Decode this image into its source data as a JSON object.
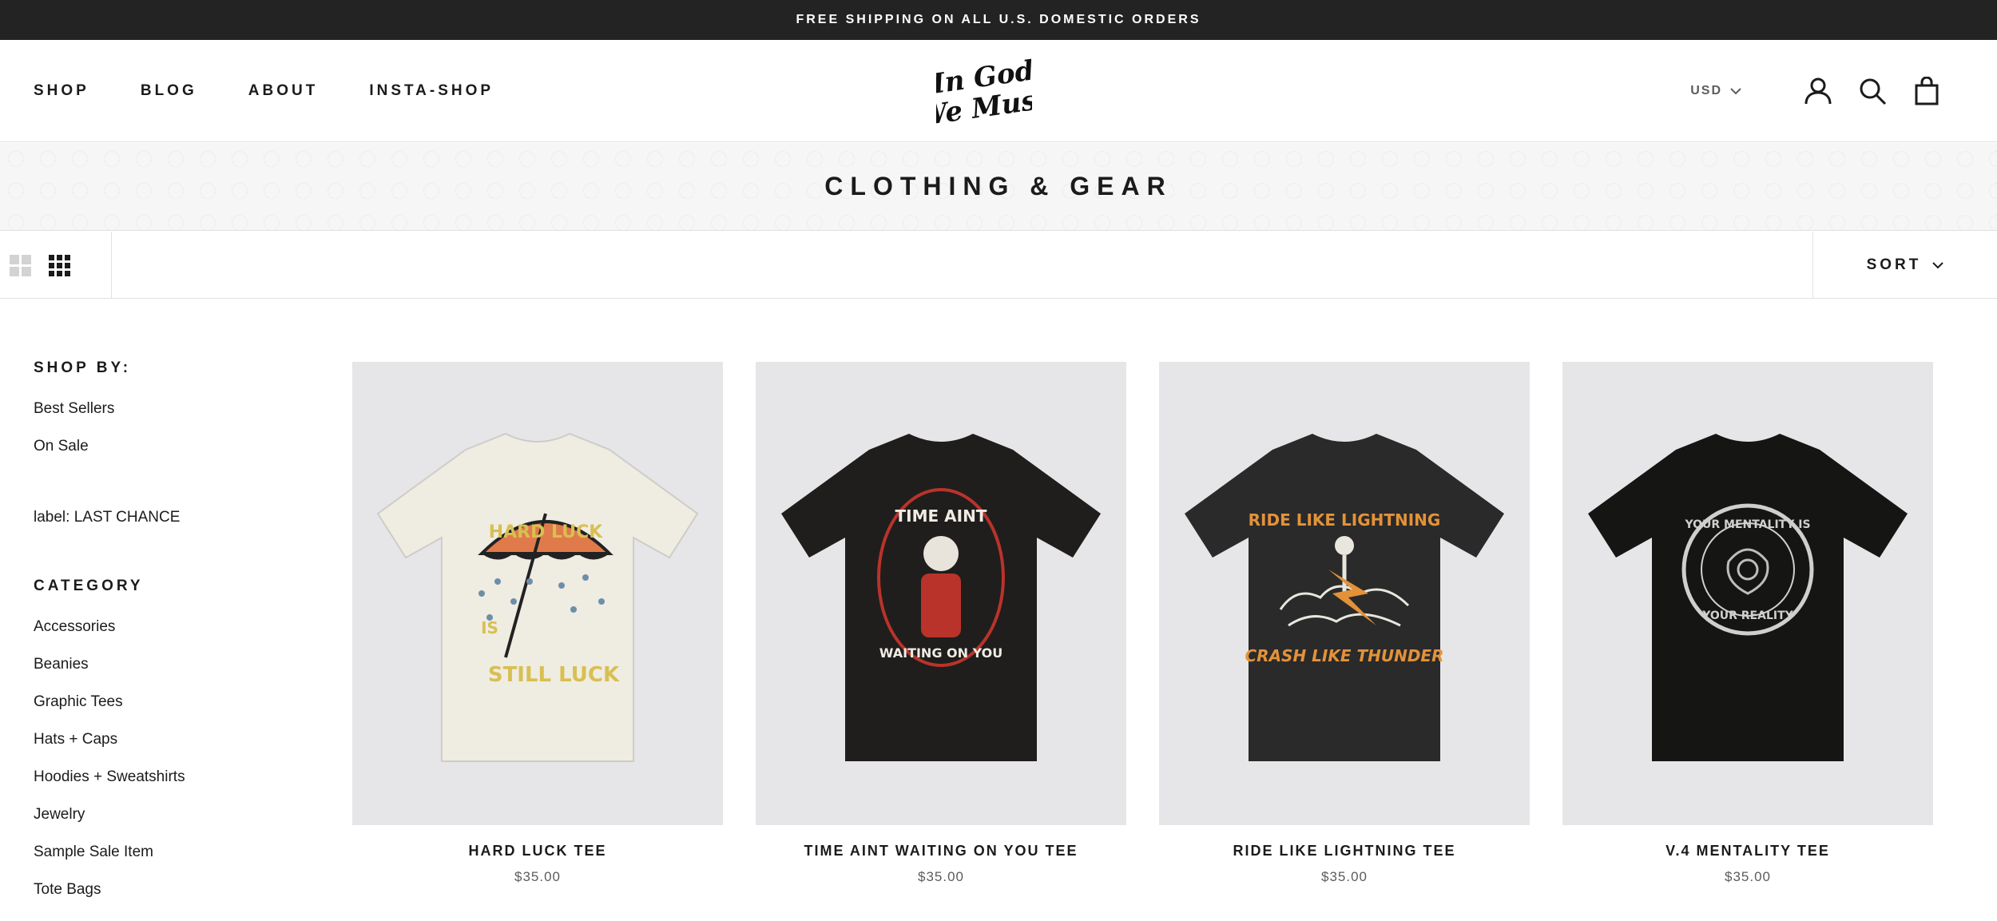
{
  "announcement": "FREE SHIPPING ON ALL U.S. DOMESTIC ORDERS",
  "nav": {
    "items": [
      "SHOP",
      "BLOG",
      "ABOUT",
      "INSTA-SHOP"
    ]
  },
  "logo": {
    "text_line1": "In God",
    "text_line2": "We Must"
  },
  "header": {
    "currency": "USD",
    "icons": [
      "account-icon",
      "search-icon",
      "cart-icon"
    ]
  },
  "collection": {
    "title": "CLOTHING & GEAR"
  },
  "toolbar": {
    "sort_label": "SORT",
    "layout_options": [
      "grid-2-icon",
      "grid-3-icon"
    ]
  },
  "sidebar": {
    "shop_by_heading": "SHOP BY:",
    "shop_by": [
      "Best Sellers",
      "On Sale"
    ],
    "label_filter": "label: LAST CHANCE",
    "category_heading": "CATEGORY",
    "categories": [
      "Accessories",
      "Beanies",
      "Graphic Tees",
      "Hats + Caps",
      "Hoodies + Sweatshirts",
      "Jewelry",
      "Sample Sale Item",
      "Tote Bags"
    ]
  },
  "products": [
    {
      "name": "HARD LUCK TEE",
      "price": "$35.00",
      "shirt_color": "#efece2",
      "graphic": {
        "top_text": "HARD LUCK",
        "middle_text": "IS",
        "bottom_text": "STILL LUCK",
        "accent": "#d8bf52",
        "umbrella": "#e07a4a"
      }
    },
    {
      "name": "TIME AINT WAITING ON YOU TEE",
      "price": "$35.00",
      "shirt_color": "#1f1e1c",
      "graphic": {
        "top_text": "TIME AINT",
        "bottom_text": "WAITING ON YOU",
        "accent": "#b9332b"
      }
    },
    {
      "name": "RIDE LIKE LIGHTNING TEE",
      "price": "$35.00",
      "shirt_color": "#2a2a2a",
      "graphic": {
        "top_text": "RIDE LIKE LIGHTNING",
        "bottom_text": "CRASH LIKE THUNDER",
        "accent": "#e3923a"
      }
    },
    {
      "name": "V.4 MENTALITY TEE",
      "price": "$35.00",
      "shirt_color": "#151514",
      "graphic": {
        "top_text": "YOUR MENTALITY IS",
        "bottom_text": "YOUR REALITY",
        "accent": "#cfcfcf"
      }
    }
  ]
}
